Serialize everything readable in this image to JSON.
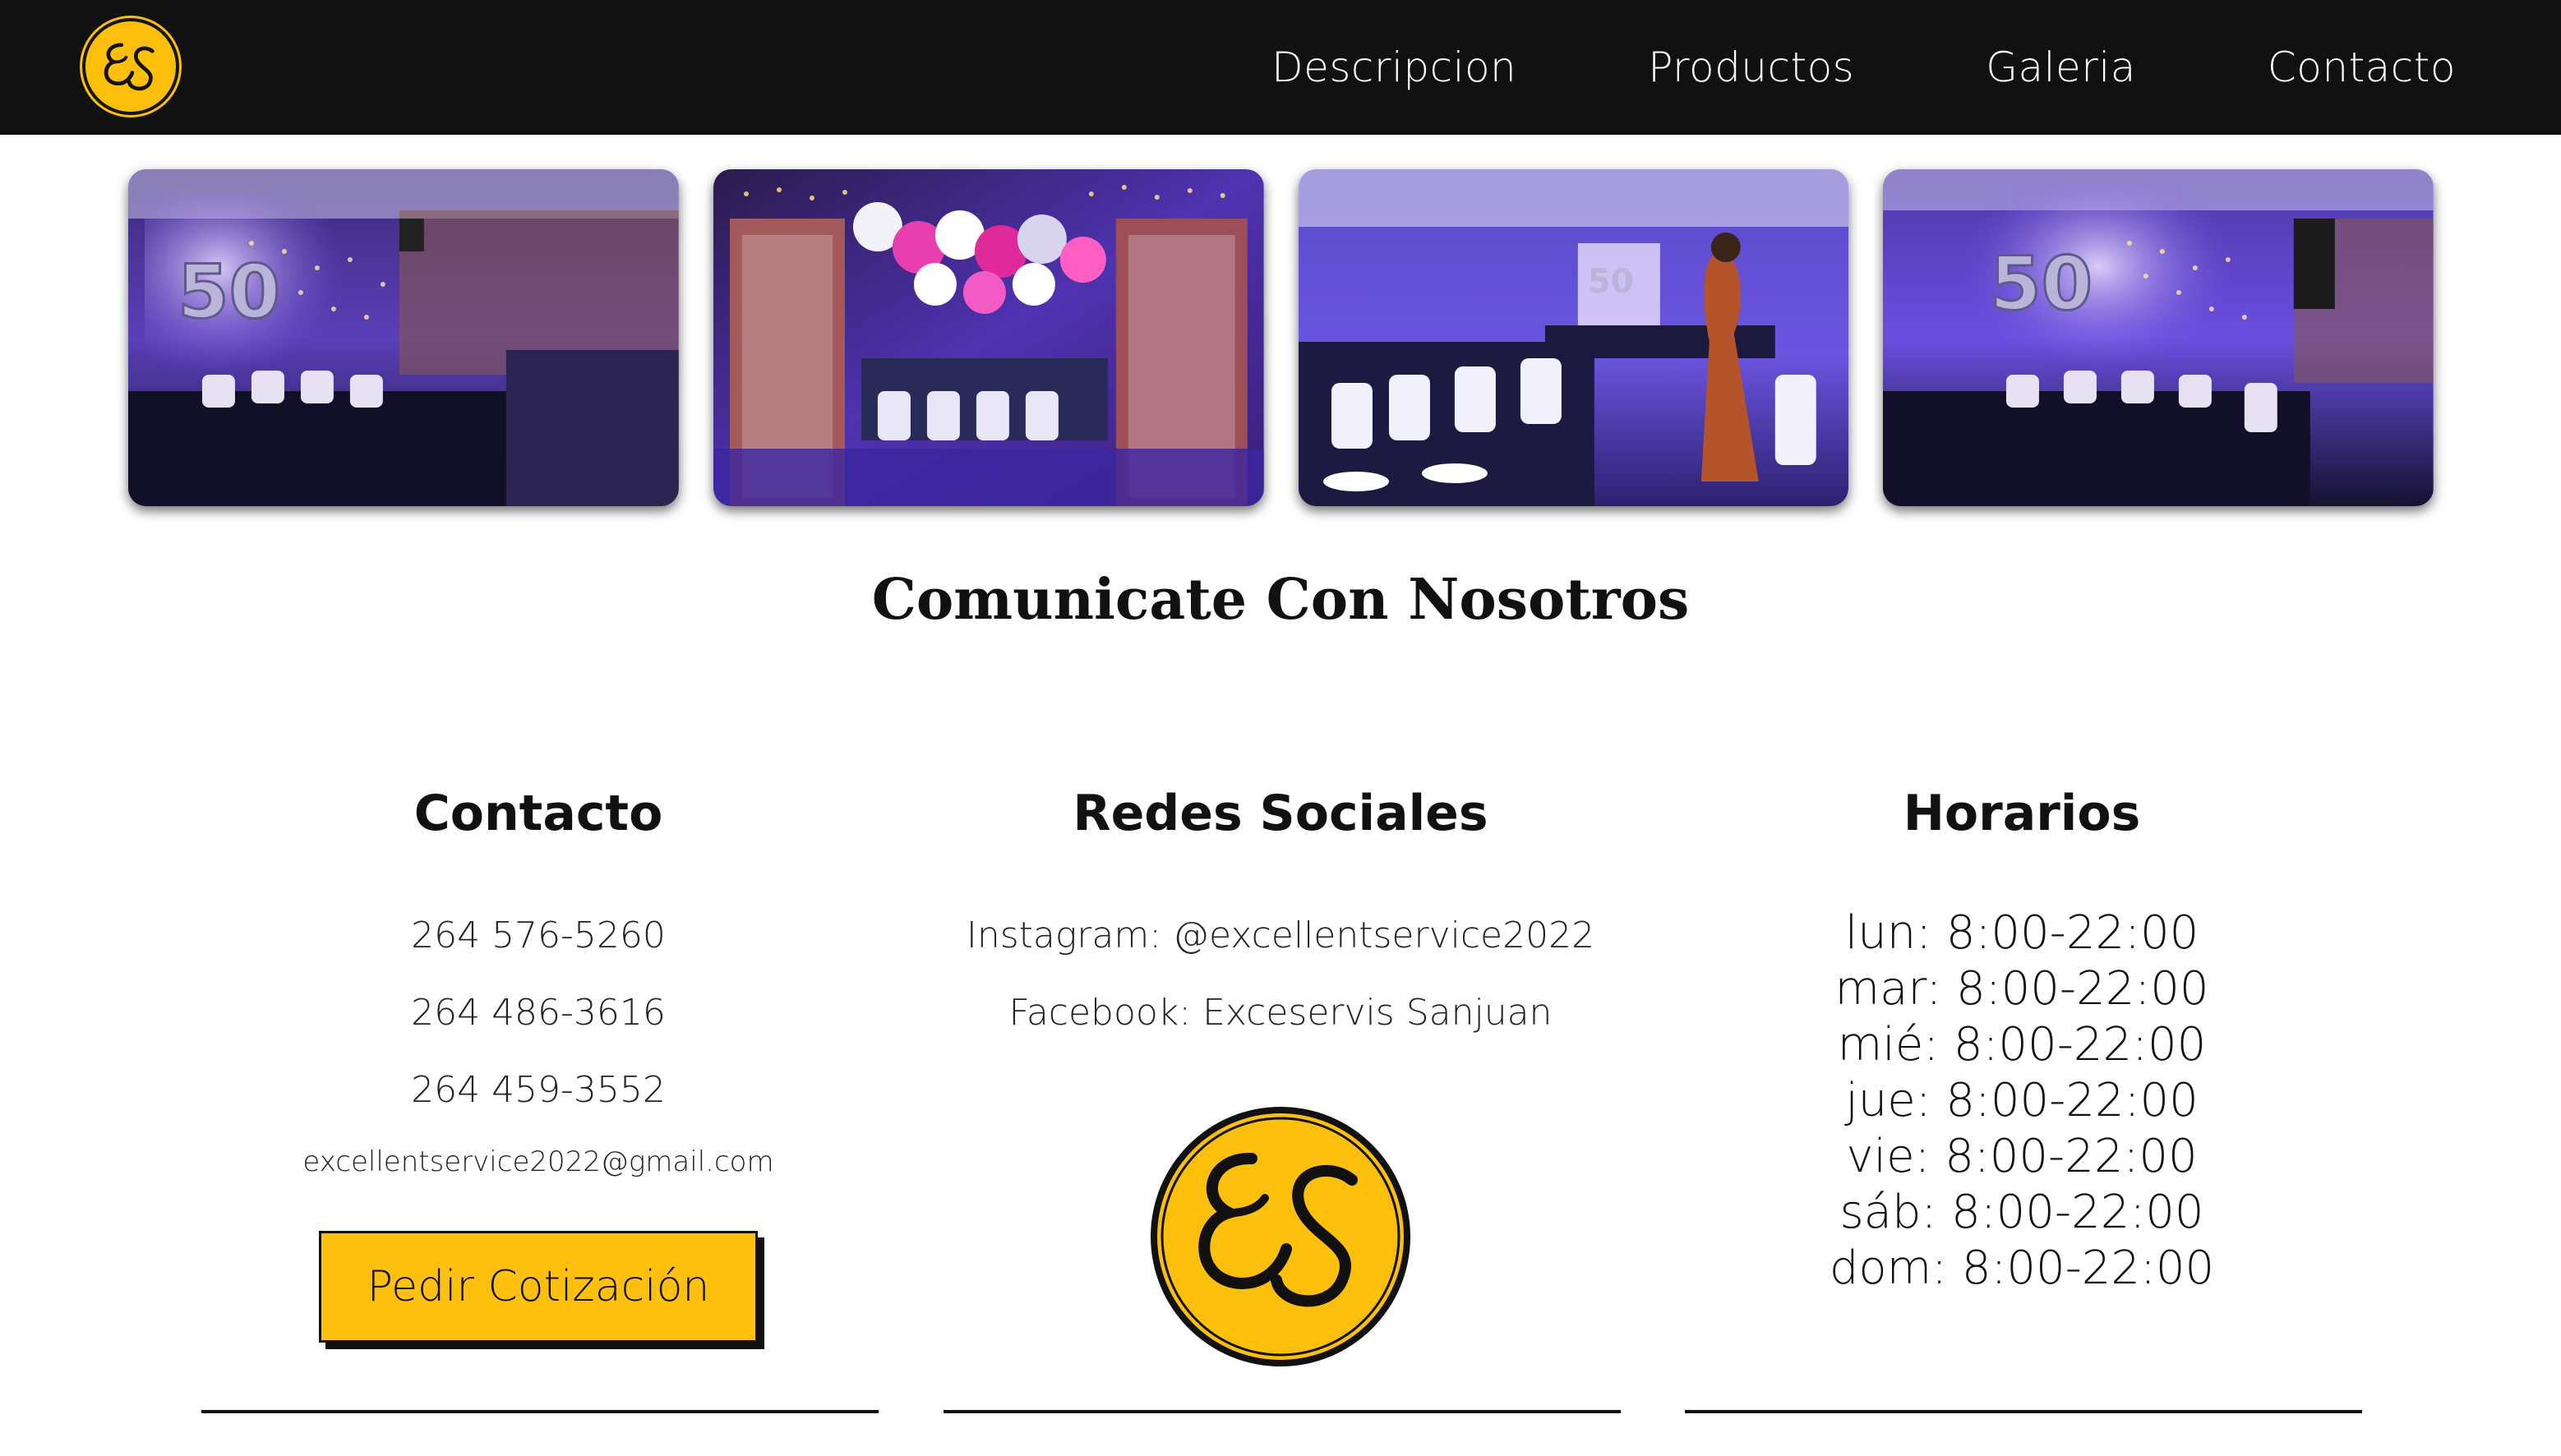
{
  "brand": {
    "logo_text": "ES",
    "logo_color": "#fbbf0c",
    "nav_background": "#111111"
  },
  "nav": {
    "items": [
      {
        "label": "Descripcion"
      },
      {
        "label": "Productos"
      },
      {
        "label": "Galeria"
      },
      {
        "label": "Contacto"
      }
    ]
  },
  "gallery": {
    "photos": [
      {
        "icon": "party-venue-photo",
        "balloon_text": "50"
      },
      {
        "icon": "balloon-doorway-photo"
      },
      {
        "icon": "dining-hall-photo",
        "balloon_text": "50"
      },
      {
        "icon": "party-venue-photo",
        "balloon_text": "50"
      }
    ]
  },
  "section": {
    "title": "Comunicate Con Nosotros"
  },
  "contact": {
    "heading": "Contacto",
    "phones": [
      "264 576-5260",
      "264 486-3616",
      "264 459-3552"
    ],
    "email": "excellentservice2022@gmail.com",
    "button_label": "Pedir Cotización",
    "button_color": "#fdc00f"
  },
  "social": {
    "heading": "Redes Sociales",
    "instagram": "Instagram: @excellentservice2022",
    "facebook": "Facebook: Exceservis Sanjuan"
  },
  "hours": {
    "heading": "Horarios",
    "days": [
      "lun: 8:00-22:00",
      "mar: 8:00-22:00",
      "mié: 8:00-22:00",
      "jue: 8:00-22:00",
      "vie: 8:00-22:00",
      "sáb: 8:00-22:00",
      "dom: 8:00-22:00"
    ]
  }
}
